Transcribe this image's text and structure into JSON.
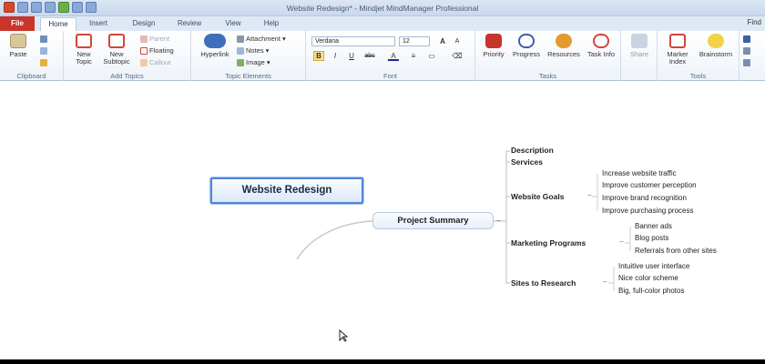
{
  "window": {
    "title": "Website Redesign* - Mindjet MindManager Professional"
  },
  "tabs": [
    "File",
    "Home",
    "Insert",
    "Design",
    "Review",
    "View",
    "Help"
  ],
  "find_label": "Find",
  "ribbon": {
    "clipboard": {
      "paste": "Paste",
      "label": "Clipboard"
    },
    "add_topics": {
      "new_topic": "New Topic",
      "new_subtopic": "New Subtopic",
      "parent": "Parent",
      "floating": "Floating",
      "callout": "Callout",
      "label": "Add Topics"
    },
    "topic_elements": {
      "hyperlink": "Hyperlink",
      "attachment": "Attachment",
      "notes": "Notes",
      "image": "Image",
      "label": "Topic Elements"
    },
    "font": {
      "family": "Verdana",
      "size": "12",
      "bold": "B",
      "italic": "I",
      "underline": "U",
      "strike": "abc",
      "color": "A",
      "label": "Font"
    },
    "tasks": {
      "priority": "Priority",
      "progress": "Progress",
      "resources": "Resources",
      "task_info": "Task Info",
      "label": "Tasks"
    },
    "share": "Share",
    "tools": {
      "marker_index": "Marker Index",
      "brainstorm": "Brainstorm",
      "label": "Tools"
    }
  },
  "map": {
    "central": "Website Redesign",
    "main": "Project Summary",
    "subtopics": [
      {
        "label": "Description",
        "children": []
      },
      {
        "label": "Services",
        "children": []
      },
      {
        "label": "Website Goals",
        "children": [
          "Increase website traffic",
          "Improve customer perception",
          "Improve brand recognition",
          "Improve purchasing process"
        ]
      },
      {
        "label": "Marketing Programs",
        "children": [
          "Banner ads",
          "Blog posts",
          "Referrals from other sites"
        ]
      },
      {
        "label": "Sites to Research",
        "children": [
          "Intuitive user interface",
          "Nice color scheme",
          "Big, full-color photos"
        ]
      }
    ]
  }
}
